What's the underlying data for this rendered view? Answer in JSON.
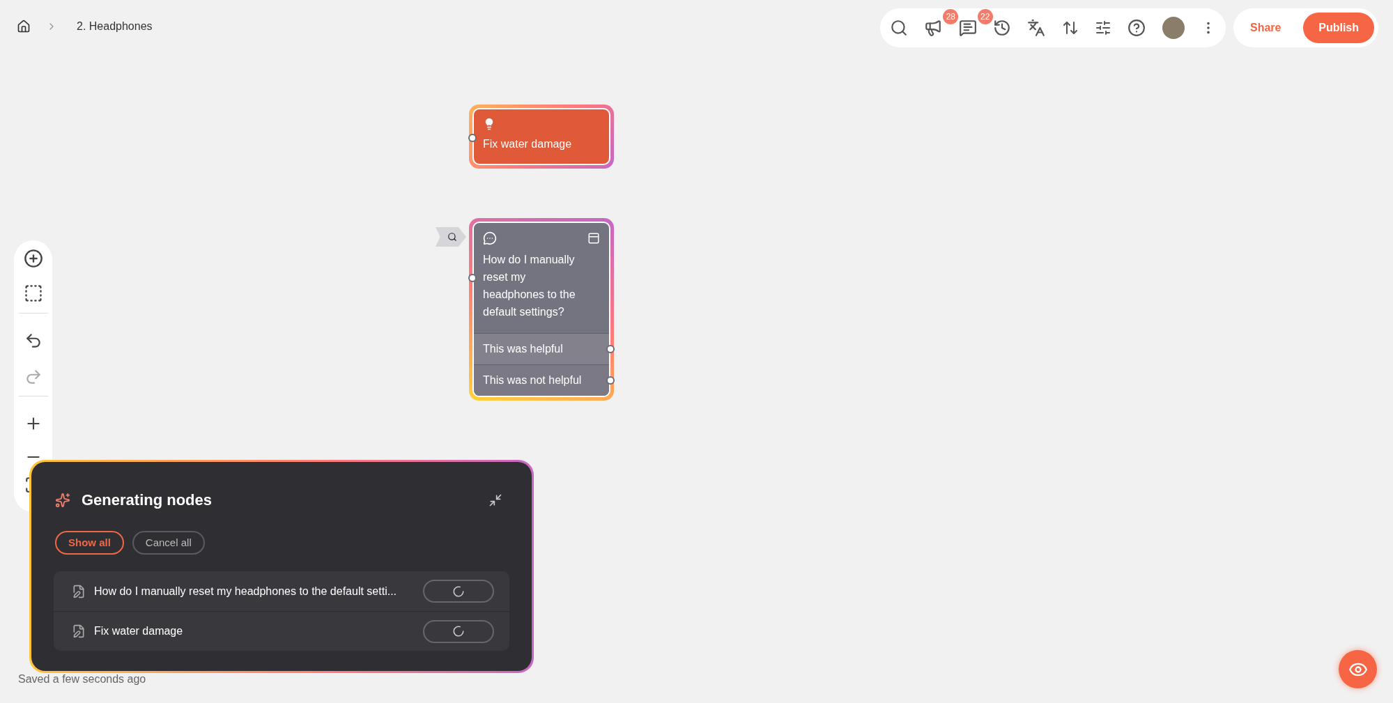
{
  "breadcrumb": {
    "current": "2. Headphones"
  },
  "toolbar": {
    "badges": [
      {
        "kind": "announcements",
        "count": "28"
      },
      {
        "kind": "comments",
        "count": "22"
      }
    ]
  },
  "actions": {
    "share": "Share",
    "publish": "Publish"
  },
  "nodes": [
    {
      "kind": "idea",
      "title": "Fix water damage"
    },
    {
      "kind": "question",
      "title": "How do I manually reset my headphones to the default settings?",
      "choices": [
        "This was helpful",
        "This was not helpful"
      ]
    }
  ],
  "generating_panel": {
    "title": "Generating nodes",
    "buttons": [
      {
        "label": "Show all",
        "selected": true
      },
      {
        "label": "Cancel all",
        "selected": false
      }
    ],
    "items": [
      "How do I manually reset my headphones to the default setti...",
      "Fix water damage"
    ]
  },
  "status": "Saved a few seconds ago"
}
